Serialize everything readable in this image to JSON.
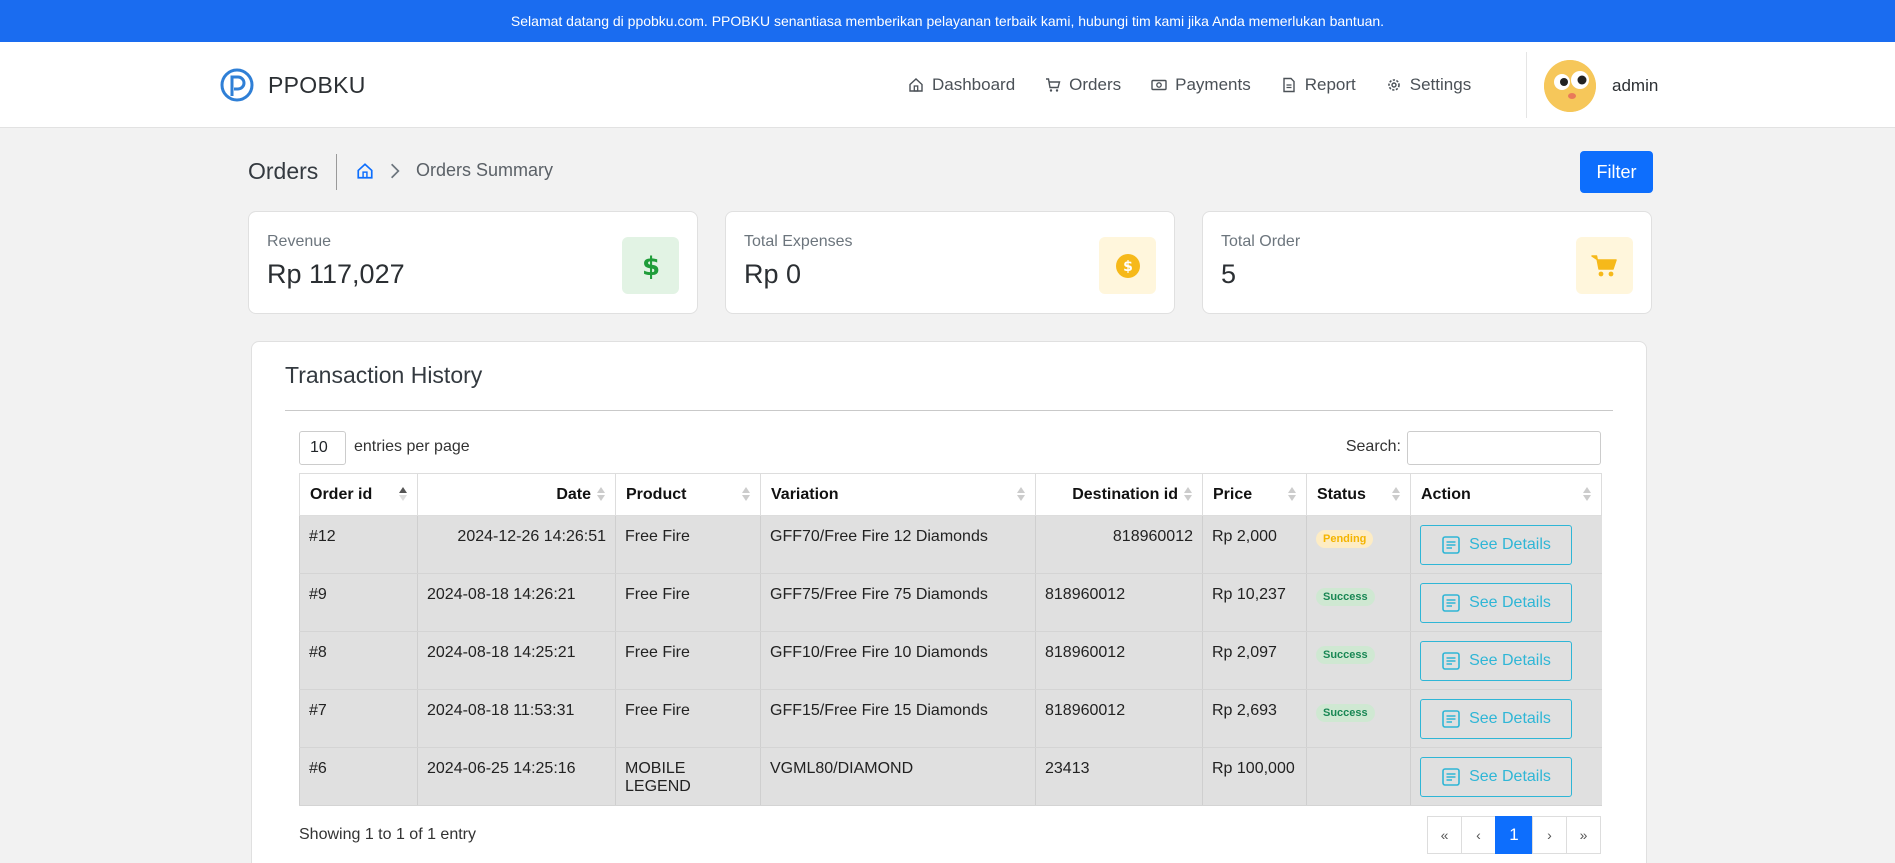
{
  "announcement": "Selamat datang di ppobku.com. PPOBKU senantiasa memberikan pelayanan terbaik kami, hubungi tim kami jika Anda memerlukan bantuan.",
  "brand": {
    "name": "PPOBKU"
  },
  "nav": {
    "items": [
      {
        "label": "Dashboard",
        "icon": "home-icon"
      },
      {
        "label": "Orders",
        "icon": "cart-icon"
      },
      {
        "label": "Payments",
        "icon": "cash-icon"
      },
      {
        "label": "Report",
        "icon": "document-icon"
      },
      {
        "label": "Settings",
        "icon": "gear-icon"
      }
    ],
    "user": "admin"
  },
  "page": {
    "title": "Orders",
    "breadcrumb": "Orders Summary",
    "filter_label": "Filter"
  },
  "stats": [
    {
      "label": "Revenue",
      "value": "Rp 117,027",
      "icon": "dollar-icon",
      "color": "#1f9d3a"
    },
    {
      "label": "Total Expenses",
      "value": "Rp 0",
      "icon": "coin-icon",
      "color": "#f6b91a"
    },
    {
      "label": "Total Order",
      "value": "5",
      "icon": "cart-icon",
      "color": "#f6b91a"
    }
  ],
  "transactions": {
    "title": "Transaction History",
    "entries_value": "10",
    "entries_label": "entries per page",
    "search_label": "Search:",
    "columns": [
      "Order id",
      "Date",
      "Product",
      "Variation",
      "Destination id",
      "Price",
      "Status",
      "Action"
    ],
    "rows": [
      {
        "id": "#12",
        "date": "2024-12-26 14:26:51",
        "product": "Free Fire",
        "variation": "GFF70/Free Fire 12 Diamonds",
        "dest": "818960012",
        "price": "Rp 2,000",
        "status": "Pending",
        "action": "See Details"
      },
      {
        "id": "#9",
        "date": "2024-08-18 14:26:21",
        "product": "Free Fire",
        "variation": "GFF75/Free Fire 75 Diamonds",
        "dest": "818960012",
        "price": "Rp 10,237",
        "status": "Success",
        "action": "See Details"
      },
      {
        "id": "#8",
        "date": "2024-08-18 14:25:21",
        "product": "Free Fire",
        "variation": "GFF10/Free Fire 10 Diamonds",
        "dest": "818960012",
        "price": "Rp 2,097",
        "status": "Success",
        "action": "See Details"
      },
      {
        "id": "#7",
        "date": "2024-08-18 11:53:31",
        "product": "Free Fire",
        "variation": "GFF15/Free Fire 15 Diamonds",
        "dest": "818960012",
        "price": "Rp 2,693",
        "status": "Success",
        "action": "See Details"
      },
      {
        "id": "#6",
        "date": "2024-06-25 14:25:16",
        "product": "MOBILE LEGEND",
        "variation": "VGML80/DIAMOND",
        "dest": "23413",
        "price": "Rp 100,000",
        "status": "",
        "action": "See Details"
      }
    ],
    "showing": "Showing 1 to 1 of 1 entry",
    "pagination": [
      "«",
      "‹",
      "1",
      "›",
      "»"
    ],
    "current_page": "1"
  }
}
